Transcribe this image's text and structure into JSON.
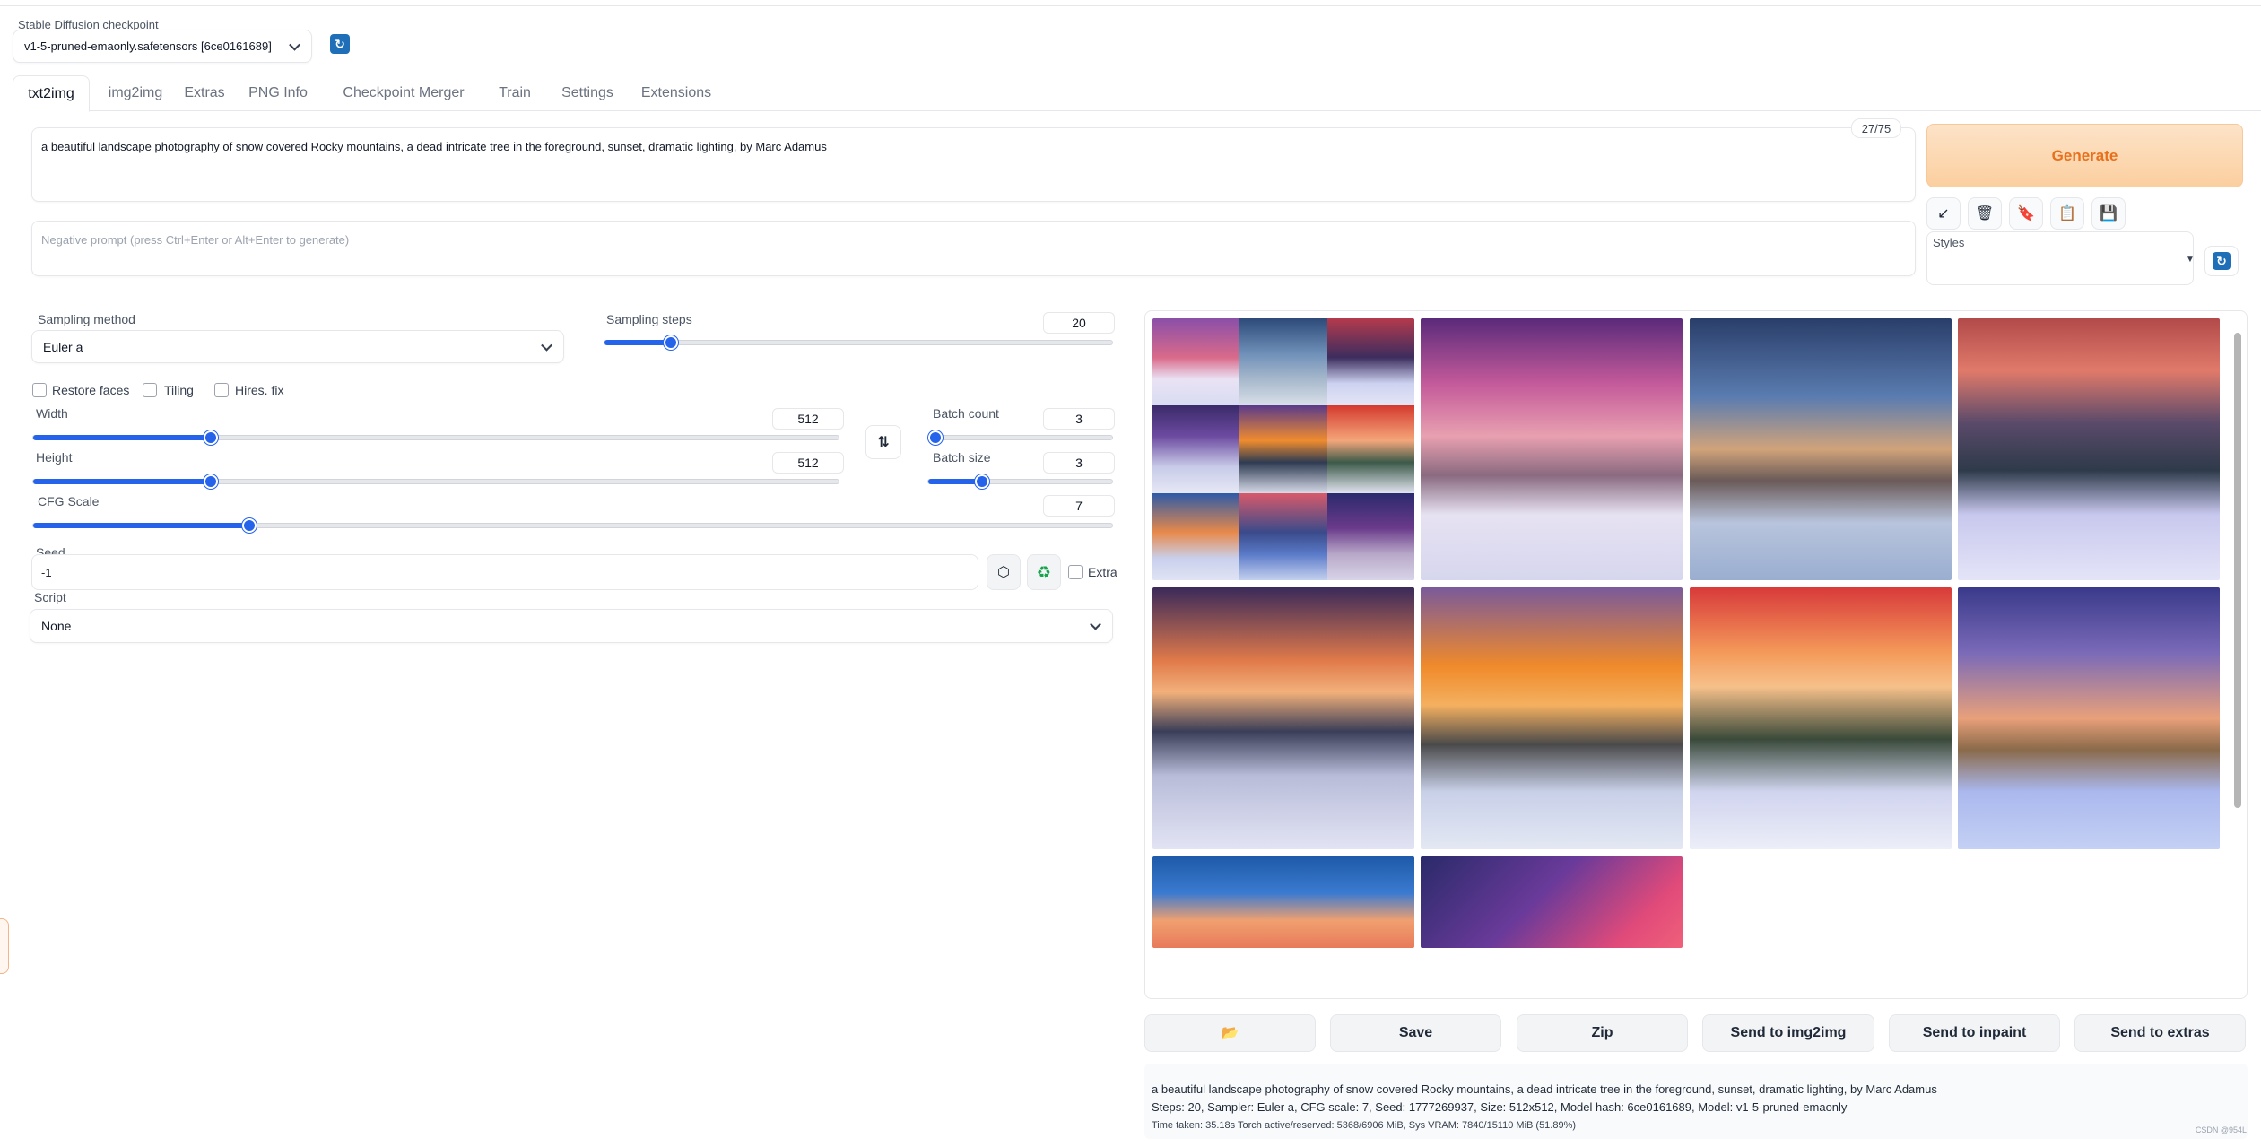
{
  "checkpoint": {
    "label": "Stable Diffusion checkpoint",
    "value": "v1-5-pruned-emaonly.safetensors [6ce0161689]"
  },
  "tabs": [
    {
      "label": "txt2img",
      "active": true
    },
    {
      "label": "img2img"
    },
    {
      "label": "Extras"
    },
    {
      "label": "PNG Info"
    },
    {
      "label": "Checkpoint Merger"
    },
    {
      "label": "Train"
    },
    {
      "label": "Settings"
    },
    {
      "label": "Extensions"
    }
  ],
  "prompt": {
    "value": "a beautiful landscape photography of snow covered Rocky mountains, a dead intricate tree in the foreground, sunset, dramatic lighting, by Marc Adamus",
    "token_count": "27/75"
  },
  "negative_prompt": {
    "placeholder": "Negative prompt (press Ctrl+Enter or Alt+Enter to generate)"
  },
  "generate_label": "Generate",
  "styles_label": "Styles",
  "sampling": {
    "method_label": "Sampling method",
    "method_value": "Euler a",
    "steps_label": "Sampling steps",
    "steps_value": "20",
    "steps_fraction": 0.13
  },
  "checkboxes": {
    "restore_faces": "Restore faces",
    "tiling": "Tiling",
    "hires_fix": "Hires. fix",
    "extra": "Extra"
  },
  "width": {
    "label": "Width",
    "value": "512",
    "fraction": 0.22
  },
  "height": {
    "label": "Height",
    "value": "512",
    "fraction": 0.22
  },
  "batch_count": {
    "label": "Batch count",
    "value": "3",
    "fraction": 0.02
  },
  "batch_size": {
    "label": "Batch size",
    "value": "3",
    "fraction": 0.29
  },
  "cfg": {
    "label": "CFG Scale",
    "value": "7",
    "fraction": 0.2
  },
  "seed": {
    "label": "Seed",
    "value": "-1"
  },
  "script": {
    "label": "Script",
    "value": "None"
  },
  "actions": {
    "save": "Save",
    "zip": "Zip",
    "send_img2img": "Send to img2img",
    "send_inpaint": "Send to inpaint",
    "send_extras": "Send to extras"
  },
  "output_info": {
    "line1": "a beautiful landscape photography of snow covered Rocky mountains, a dead intricate tree in the foreground, sunset, dramatic lighting, by Marc Adamus",
    "line2": "Steps: 20, Sampler: Euler a, CFG scale: 7, Seed: 1777269937, Size: 512x512, Model hash: 6ce0161689, Model: v1-5-pruned-emaonly",
    "line3": "Time taken: 35.18s  Torch active/reserved: 5368/6906 MiB, Sys VRAM: 7840/15110 MiB (51.89%)"
  },
  "watermark": "CSDN @954L",
  "icons": {
    "refresh": "refresh-icon",
    "swap": "swap-arrows-icon",
    "dice": "dice-icon",
    "recycle": "recycle-icon",
    "folder": "folder-icon",
    "trash": "trash-icon",
    "arrow": "diagonal-arrow-icon",
    "bookmark": "red-bookmark-icon",
    "clipboard": "clipboard-icon",
    "save": "save-disk-icon"
  },
  "accent_color": "#2563eb",
  "generate_color": "#e8701c"
}
